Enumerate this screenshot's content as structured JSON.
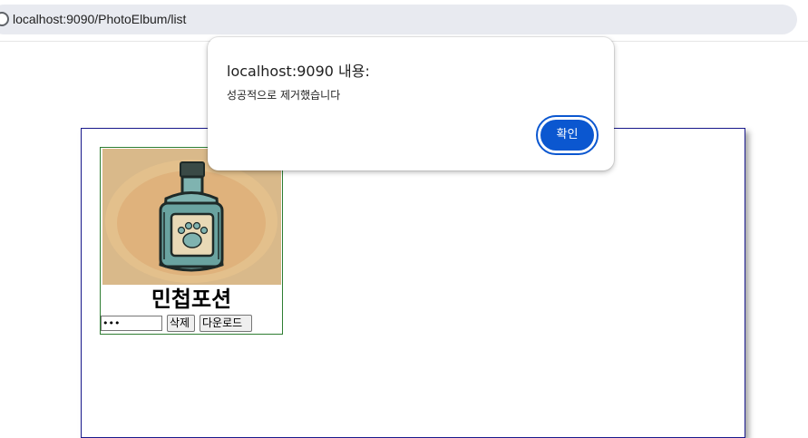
{
  "browser": {
    "url": "localhost:9090/PhotoElbum/list"
  },
  "album": {
    "photo": {
      "title": "민첩포션",
      "password_value": "•••",
      "delete_label": "삭제",
      "download_label": "다운로드"
    }
  },
  "dialog": {
    "title": "localhost:9090 내용:",
    "message": "성공적으로 제거했습니다",
    "ok_label": "확인"
  },
  "colors": {
    "accent": "#0b57d0",
    "frame_border": "#1a1a8c",
    "card_border": "#2e7d32"
  }
}
